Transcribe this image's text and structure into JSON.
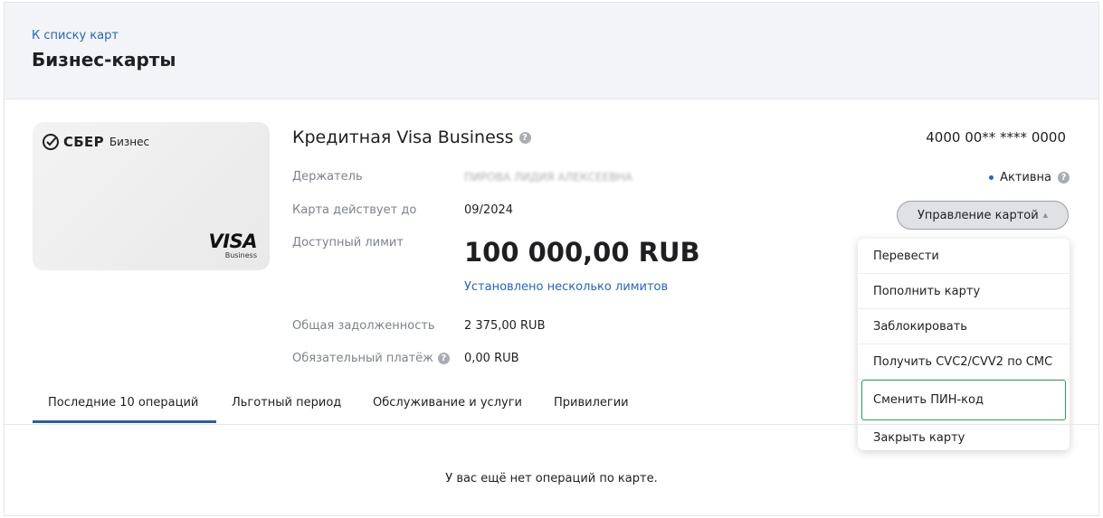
{
  "header": {
    "back_link": "К списку карт",
    "title": "Бизнес-карты"
  },
  "card_image": {
    "brand": "СБЕР",
    "brand_sub": "Бизнес",
    "network": "VISA",
    "network_sub": "Business"
  },
  "card": {
    "name": "Кредитная Visa Business",
    "number": "4000 00** **** 0000",
    "status": "Активна",
    "fields": {
      "holder_label": "Держатель",
      "holder_value": "ПИРОВА ЛИДИЯ АЛЕКСЕЕВНА",
      "valid_label": "Карта действует до",
      "valid_value": "09/2024",
      "limit_label": "Доступный лимит",
      "limit_value": "100 000,00 RUB",
      "limits_link": "Установлено несколько лимитов",
      "debt_label": "Общая задолженность",
      "debt_value": "2 375,00 RUB",
      "payment_label": "Обязательный платёж",
      "payment_value": "0,00 RUB"
    }
  },
  "manage": {
    "button_label": "Управление картой",
    "menu": [
      "Перевести",
      "Пополнить карту",
      "Заблокировать",
      "Получить CVC2/CVV2 по СМС",
      "Сменить ПИН-код",
      "Закрыть карту"
    ]
  },
  "tabs": [
    "Последние 10 операций",
    "Льготный период",
    "Обслуживание и услуги",
    "Привилегии"
  ],
  "empty_message": "У вас ещё нет операций по карте.",
  "colors": {
    "link": "#2965b6",
    "header_bg": "#f2f4f7",
    "tab_active": "#2f5e8c",
    "focus_outline": "#2e9a5a"
  }
}
